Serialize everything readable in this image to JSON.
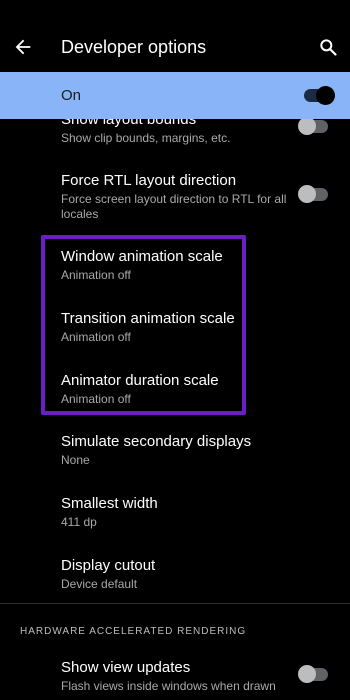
{
  "header": {
    "title": "Developer options",
    "back_icon": "arrow-left-icon",
    "search_icon": "search-icon"
  },
  "master_switch": {
    "label": "On",
    "state": "on"
  },
  "items": {
    "show_layout_bounds": {
      "title": "Show layout bounds",
      "subtitle": "Show clip bounds, margins, etc.",
      "toggle": "off"
    },
    "force_rtl": {
      "title": "Force RTL layout direction",
      "subtitle": "Force screen layout direction to RTL for all locales",
      "toggle": "off"
    },
    "window_animation": {
      "title": "Window animation scale",
      "subtitle": "Animation off"
    },
    "transition_animation": {
      "title": "Transition animation scale",
      "subtitle": "Animation off"
    },
    "animator_duration": {
      "title": "Animator duration scale",
      "subtitle": "Animation off"
    },
    "secondary_displays": {
      "title": "Simulate secondary displays",
      "subtitle": "None"
    },
    "smallest_width": {
      "title": "Smallest width",
      "subtitle": "411 dp"
    },
    "display_cutout": {
      "title": "Display cutout",
      "subtitle": "Device default"
    },
    "show_view_updates": {
      "title": "Show view updates",
      "subtitle": "Flash views inside windows when drawn",
      "toggle": "off"
    }
  },
  "sections": {
    "hardware_rendering": "HARDWARE ACCELERATED RENDERING"
  },
  "colors": {
    "accent": "#8ab4f8",
    "highlight_border": "#6a1fc5",
    "background": "#000000"
  }
}
